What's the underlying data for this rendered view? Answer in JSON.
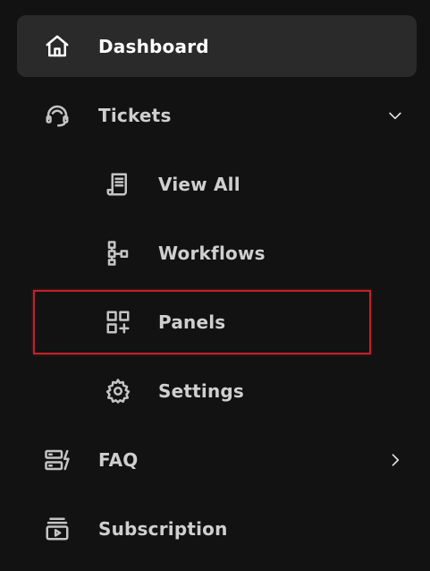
{
  "nav": {
    "dashboard": {
      "label": "Dashboard",
      "icon": "home-icon",
      "active": true
    },
    "tickets": {
      "label": "Tickets",
      "icon": "headset-icon",
      "expanded": true,
      "children": {
        "view_all": {
          "label": "View All",
          "icon": "receipt-icon"
        },
        "workflows": {
          "label": "Workflows",
          "icon": "hierarchy-icon"
        },
        "panels": {
          "label": "Panels",
          "icon": "grid-add-icon"
        },
        "settings": {
          "label": "Settings",
          "icon": "gear-icon"
        }
      }
    },
    "faq": {
      "label": "FAQ",
      "icon": "server-bolt-icon"
    },
    "subscription": {
      "label": "Subscription",
      "icon": "video-stack-icon"
    }
  },
  "colors": {
    "background": "#121212",
    "active_background": "#2a2a2a",
    "text": "#cfcfcf",
    "active_text": "#ffffff",
    "highlight_border": "#c0222b"
  }
}
